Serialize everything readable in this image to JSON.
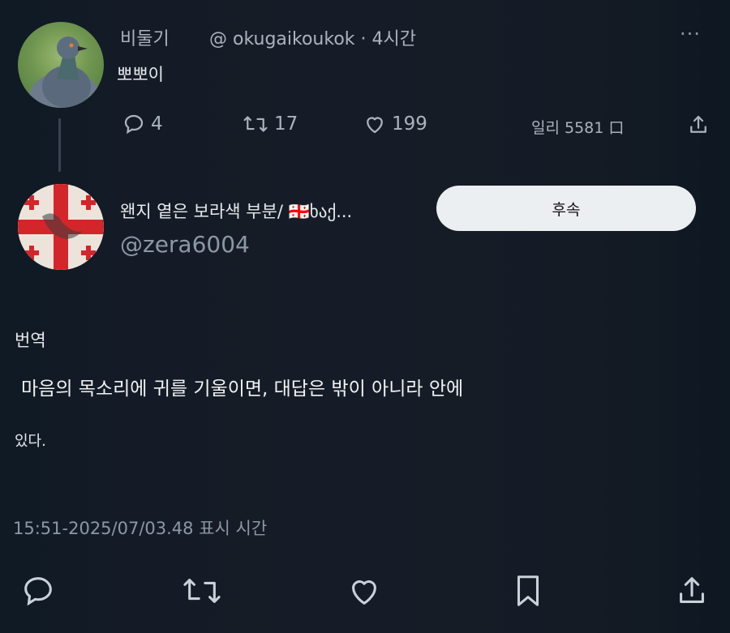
{
  "post": {
    "display_name": "비둘기",
    "handle_time": "@ okugaikoukok · 4시간",
    "text": "뽀뽀이",
    "more_label": "···",
    "stats": {
      "replies": "4",
      "reposts": "17",
      "likes": "199",
      "views": "일리 5581 口"
    }
  },
  "reply": {
    "display_name": "왠지 옅은 보라색 부분/ 🇬🇪ხაქ...",
    "handle": "@zera6004",
    "follow_label": "후속",
    "translate_label": "번역",
    "text_line1": "마음의 목소리에 귀를 기울이면, 대답은 밖이 아니라 안에",
    "text_line2": "있다.",
    "timestamp": "15:51-2025/07/03.48 표시 시간"
  },
  "icons": {
    "reply": "comment-icon",
    "repost": "repost-icon",
    "like": "heart-icon",
    "bookmark": "bookmark-icon",
    "share": "share-icon"
  }
}
